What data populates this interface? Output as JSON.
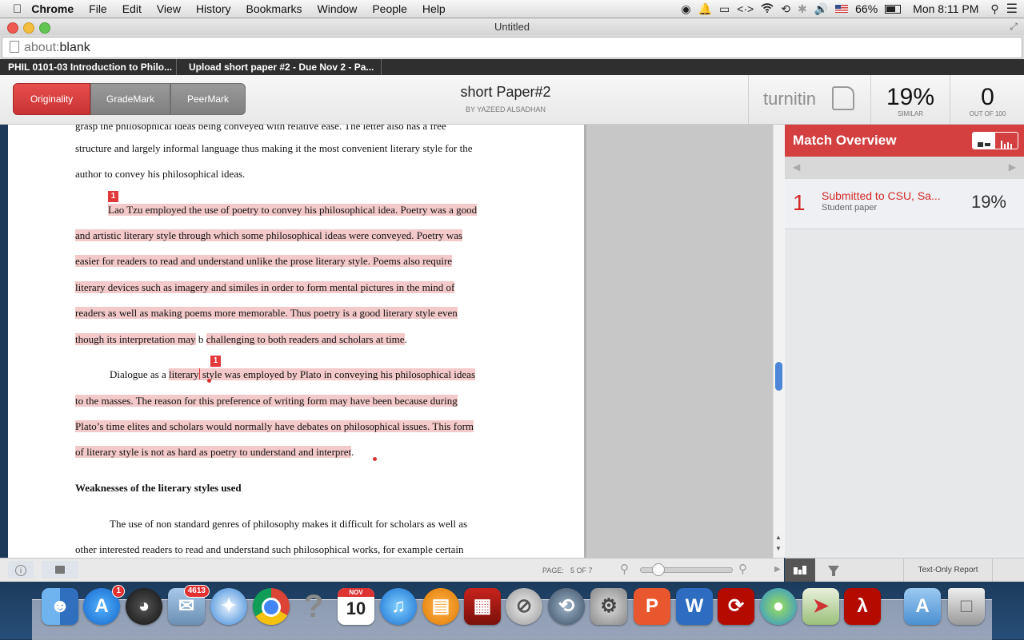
{
  "menubar": {
    "apple_icon": "apple-logo-icon",
    "app_name": "Chrome",
    "items": [
      "File",
      "Edit",
      "View",
      "History",
      "Bookmarks",
      "Window",
      "People",
      "Help"
    ],
    "battery_pct": "66%",
    "clock": "Mon 8:11 PM"
  },
  "window": {
    "title": "Untitled",
    "url_scheme": "about:",
    "url_rest": "blank"
  },
  "tabs": [
    {
      "label": "PHIL 0101-03 Introduction to Philo..."
    },
    {
      "label": "Upload short paper #2 - Due Nov 2 - Pa..."
    }
  ],
  "turnitin": {
    "modes": [
      "Originality",
      "GradeMark",
      "PeerMark"
    ],
    "doc_title": "short Paper#2",
    "doc_author": "BY YAZEED ALSADHAN",
    "logo": "turnitin",
    "similarity": {
      "value": "19%",
      "label": "SIMILAR"
    },
    "grade": {
      "value": "0",
      "label": "OUT OF 100"
    }
  },
  "document": {
    "top_cut": "grasp the philosophical ideas being conveyed with relative ease. The letter also has a free",
    "p1": [
      "structure and largely informal language thus making it the most convenient literary style for the",
      "author to convey his philosophical ideas."
    ],
    "badge": "1",
    "p2": [
      "Lao Tzu employed the use of poetry to convey his philosophical idea. Poetry was a good",
      "and artistic literary style through which some philosophical ideas were conveyed. Poetry was",
      "easier for readers to read and understand unlike the prose literary style. Poems also require",
      "literary devices such as imagery and similes in order to form mental pictures in the mind of",
      "readers as well as making poems more memorable. Thus poetry is a good literary style even"
    ],
    "p2_last": {
      "a": "though its interpretation may",
      "b": " b ",
      "c": "challenging to both readers and scholars at time",
      "d": "."
    },
    "p3_first": {
      "a": "Dialogue as a ",
      "b": "literary",
      "c": " style was employed by Plato in conveying his philosophical ideas"
    },
    "p3": [
      "to the masses. The reason for this preference of writing form may have been because during",
      "Plato’s time elites and scholars would normally have debates on philosophical issues. This form",
      "of literary style is not as hard as poetry to understand and interpret"
    ],
    "p3_end": ".",
    "heading": "Weaknesses of the literary styles used",
    "p4": [
      "The use of non standard genres of philosophy makes it difficult for scholars as well as",
      "other interested readers to read and understand such philosophical works, for example  certain"
    ]
  },
  "match_overview": {
    "title": "Match Overview",
    "match": {
      "rank": "1",
      "source": "Submitted to CSU, Sa...",
      "type": "Student paper",
      "percent": "19%"
    }
  },
  "doc_toolbar": {
    "page_label": "PAGE:",
    "page_value": "5 OF 7",
    "zoom_level": 0.12
  },
  "side_toolbar": {
    "text_only": "Text-Only Report"
  },
  "dock": {
    "appstore_badge": "1",
    "mail_badge": "4613",
    "calendar_month": "NOV",
    "calendar_day": "10"
  },
  "colors": {
    "turnitin_red": "#d44040",
    "highlight": "#f4c9c9",
    "badge_red": "#e23a3a"
  }
}
